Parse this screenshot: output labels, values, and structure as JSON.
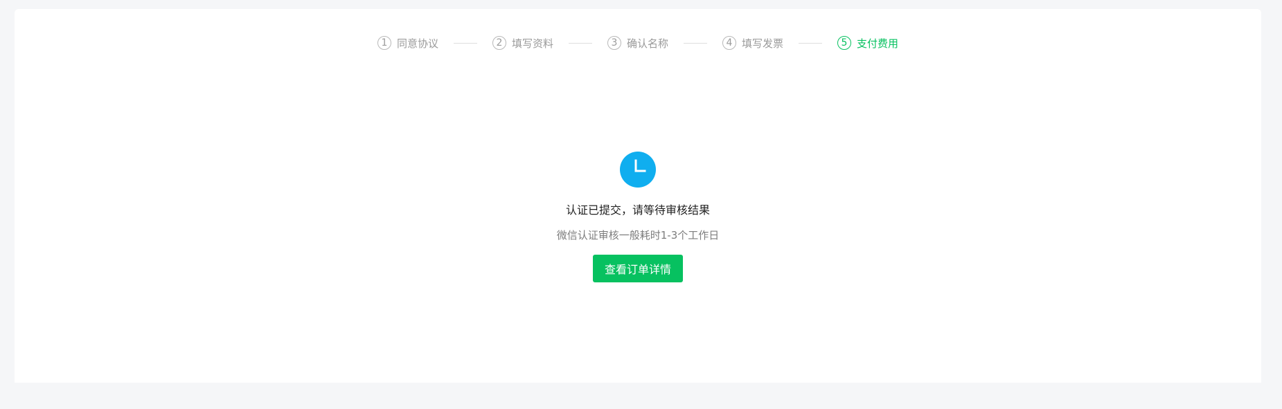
{
  "steps": [
    {
      "num": "1",
      "label": "同意协议"
    },
    {
      "num": "2",
      "label": "填写资料"
    },
    {
      "num": "3",
      "label": "确认名称"
    },
    {
      "num": "4",
      "label": "填写发票"
    },
    {
      "num": "5",
      "label": "支付费用"
    }
  ],
  "active_step": "5",
  "result": {
    "icon": "clock-icon",
    "title": "认证已提交，请等待审核结果",
    "description": "微信认证审核一般耗时1-3个工作日",
    "button_label": "查看订单详情"
  },
  "colors": {
    "accent_green": "#07c160",
    "icon_blue": "#10aeef",
    "step_gray": "#9a9a9a"
  }
}
